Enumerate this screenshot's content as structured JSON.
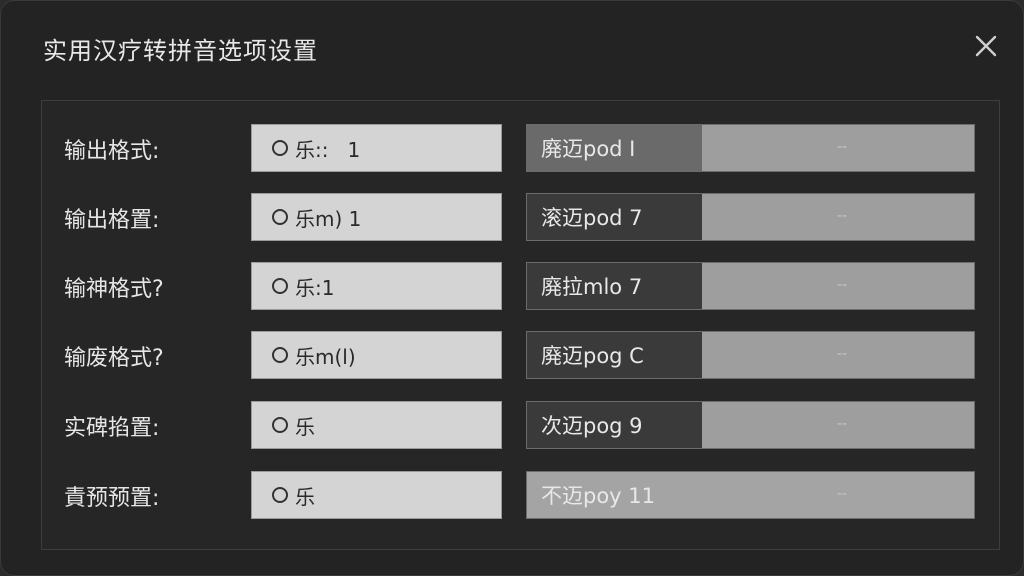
{
  "dialog": {
    "title": "实用汉疗转拼音选项设置",
    "close_icon": "close-icon"
  },
  "rows": [
    {
      "label": "输出格式:",
      "radio": "乐::   1",
      "combo_value": "廃迈pod I",
      "arrow": "--"
    },
    {
      "label": "输出格置:",
      "radio": "乐m) 1",
      "combo_value": "滚迈pod 7",
      "arrow": "--"
    },
    {
      "label": "输神格式?",
      "radio": "乐:1",
      "combo_value": "廃拉mlo 7",
      "arrow": "--"
    },
    {
      "label": "输废格式?",
      "radio": "乐m(l)",
      "combo_value": "廃迈pog C",
      "arrow": "--"
    },
    {
      "label": "实碑掐置:",
      "radio": "乐",
      "combo_value": "次迈pog 9",
      "arrow": "--"
    },
    {
      "label": "責预预置:",
      "radio": "乐",
      "combo_value": "不迈poy 11",
      "arrow": "--"
    }
  ],
  "colors": {
    "background": "#232323",
    "field": "#d4d4d4",
    "combo": "#9e9e9e",
    "combo_value": "#3a3a3a"
  }
}
